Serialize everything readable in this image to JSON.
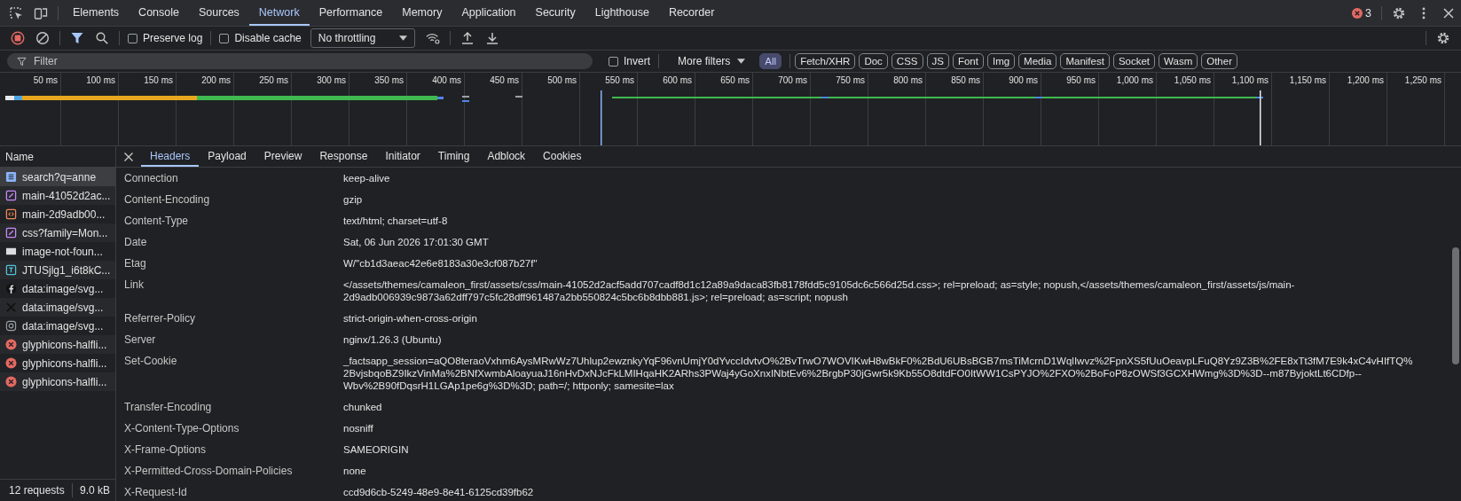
{
  "tabs": [
    {
      "label": "Elements",
      "selected": false
    },
    {
      "label": "Console",
      "selected": false
    },
    {
      "label": "Sources",
      "selected": false
    },
    {
      "label": "Network",
      "selected": true
    },
    {
      "label": "Performance",
      "selected": false
    },
    {
      "label": "Memory",
      "selected": false
    },
    {
      "label": "Application",
      "selected": false
    },
    {
      "label": "Security",
      "selected": false
    },
    {
      "label": "Lighthouse",
      "selected": false
    },
    {
      "label": "Recorder",
      "selected": false
    }
  ],
  "error_count": "3",
  "toolbar": {
    "preserve_log": {
      "label": "Preserve log",
      "checked": false
    },
    "disable_cache": {
      "label": "Disable cache",
      "checked": false
    },
    "throttling": "No throttling"
  },
  "filter": {
    "placeholder": "Filter",
    "invert": {
      "label": "Invert",
      "checked": false
    },
    "more_filters": "More filters",
    "types": [
      {
        "label": "All",
        "selected": true
      },
      {
        "label": "Fetch/XHR",
        "selected": false
      },
      {
        "label": "Doc",
        "selected": false
      },
      {
        "label": "CSS",
        "selected": false
      },
      {
        "label": "JS",
        "selected": false
      },
      {
        "label": "Font",
        "selected": false
      },
      {
        "label": "Img",
        "selected": false
      },
      {
        "label": "Media",
        "selected": false
      },
      {
        "label": "Manifest",
        "selected": false
      },
      {
        "label": "Socket",
        "selected": false
      },
      {
        "label": "Wasm",
        "selected": false
      },
      {
        "label": "Other",
        "selected": false
      }
    ]
  },
  "timeline": {
    "ticks": [
      "50 ms",
      "100 ms",
      "150 ms",
      "200 ms",
      "250 ms",
      "300 ms",
      "350 ms",
      "400 ms",
      "450 ms",
      "500 ms",
      "550 ms",
      "600 ms",
      "650 ms",
      "700 ms",
      "750 ms",
      "800 ms",
      "850 ms",
      "900 ms",
      "950 ms",
      "1,000 ms",
      "1,050 ms",
      "1,100 ms",
      "1,150 ms",
      "1,200 ms",
      "1,250 ms"
    ]
  },
  "requests": {
    "column": "Name",
    "rows": [
      {
        "name": "search?q=anne",
        "kind": "doc",
        "selected": true
      },
      {
        "name": "main-41052d2ac...",
        "kind": "css",
        "selected": false
      },
      {
        "name": "main-2d9adb00...",
        "kind": "js",
        "selected": false
      },
      {
        "name": "css?family=Mon...",
        "kind": "css",
        "selected": false
      },
      {
        "name": "image-not-foun...",
        "kind": "image",
        "selected": false
      },
      {
        "name": "JTUSjlg1_i6t8kC...",
        "kind": "font",
        "selected": false
      },
      {
        "name": "data:image/svg...",
        "kind": "round",
        "selected": false
      },
      {
        "name": "data:image/svg...",
        "kind": "cross",
        "selected": false
      },
      {
        "name": "data:image/svg...",
        "kind": "camera",
        "selected": false
      },
      {
        "name": "glyphicons-halfli...",
        "kind": "error",
        "selected": false
      },
      {
        "name": "glyphicons-halfli...",
        "kind": "error",
        "selected": false
      },
      {
        "name": "glyphicons-halfli...",
        "kind": "error",
        "selected": false
      }
    ],
    "summary": {
      "requests": "12 requests",
      "size": "9.0 kB"
    }
  },
  "detail_tabs": [
    {
      "label": "Headers",
      "selected": true
    },
    {
      "label": "Payload",
      "selected": false
    },
    {
      "label": "Preview",
      "selected": false
    },
    {
      "label": "Response",
      "selected": false
    },
    {
      "label": "Initiator",
      "selected": false
    },
    {
      "label": "Timing",
      "selected": false
    },
    {
      "label": "Adblock",
      "selected": false
    },
    {
      "label": "Cookies",
      "selected": false
    }
  ],
  "headers": [
    {
      "name": "Connection",
      "lines": [
        "keep-alive"
      ]
    },
    {
      "name": "Content-Encoding",
      "lines": [
        "gzip"
      ]
    },
    {
      "name": "Content-Type",
      "lines": [
        "text/html; charset=utf-8"
      ]
    },
    {
      "name": "Date",
      "lines": [
        "Sat, 06 Jun 2026 17:01:30 GMT"
      ]
    },
    {
      "name": "Etag",
      "lines": [
        "W/\"cb1d3aeac42e6e8183a30e3cf087b27f\""
      ]
    },
    {
      "name": "Link",
      "lines": [
        "</assets/themes/camaleon_first/assets/css/main-41052d2acf5add707cadf8d1c12a89a9daca83fb8178fdd5c9105dc6c566d25d.css>; rel=preload; as=style; nopush,</assets/themes/camaleon_first/assets/js/main-",
        "2d9adb006939c9873a62dff797c5fc28dff961487a2bb550824c5bc6b8dbb881.js>; rel=preload; as=script; nopush"
      ]
    },
    {
      "name": "Referrer-Policy",
      "lines": [
        "strict-origin-when-cross-origin"
      ]
    },
    {
      "name": "Server",
      "lines": [
        "nginx/1.26.3 (Ubuntu)"
      ]
    },
    {
      "name": "Set-Cookie",
      "lines": [
        "_factsapp_session=aQO8teraoVxhm6AysMRwWz7Uhlup2ewznkyYqF96vnUmjY0dYvccIdvtvO%2BvTrwO7WOVIKwH8wBkF0%2BdU6UBsBGB7msTiMcrnD1WqlIwvz%2FpnXS5fUuOeavpLFuQ8Yz9Z3B%2FE8xTt3fM7E9k4xC4vHIfTQ%",
        "2BvjsbqoBZ9IkzVinMa%2BNfXwmbAloayuaJ16nHvDxNJcFkLMIHqaHK2ARhs3PWaj4yGoXnxINbtEv6%2BrgbP30jGwr5k9Kb55O8dtdFO0ItWW1CsPYJO%2FXO%2BoFoP8zOWSf3GCXHWmg%3D%3D--m87ByjoktLt6CDfp--",
        "Wbv%2B90fDqsrH1LGAp1pe6g%3D%3D; path=/; httponly; samesite=lax"
      ]
    },
    {
      "name": "Transfer-Encoding",
      "lines": [
        "chunked"
      ]
    },
    {
      "name": "X-Content-Type-Options",
      "lines": [
        "nosniff"
      ]
    },
    {
      "name": "X-Frame-Options",
      "lines": [
        "SAMEORIGIN"
      ]
    },
    {
      "name": "X-Permitted-Cross-Domain-Policies",
      "lines": [
        "none"
      ]
    },
    {
      "name": "X-Request-Id",
      "lines": [
        "ccd9d6cb-5249-48e9-8e41-6125cd39fb62"
      ]
    }
  ]
}
